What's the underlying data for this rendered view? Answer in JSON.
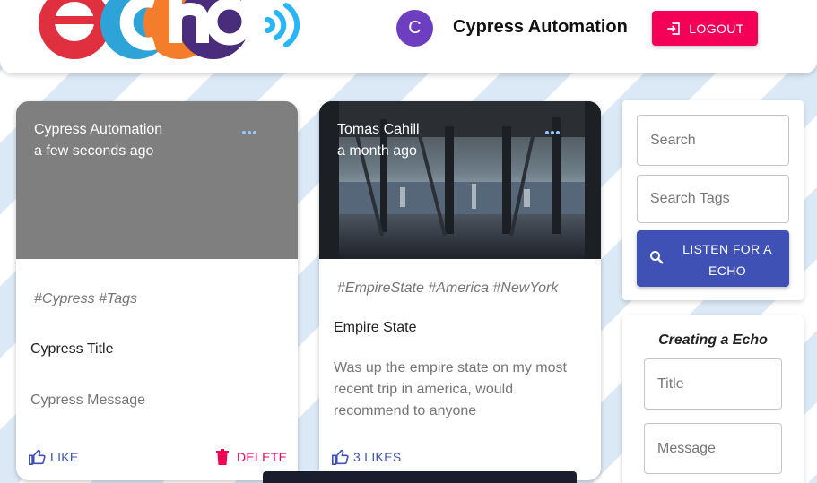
{
  "header": {
    "logo_text": "echo",
    "avatar_initial": "C",
    "username": "Cypress Automation",
    "logout_label": "LOGOUT"
  },
  "posts": [
    {
      "author": "Cypress Automation",
      "time": "a few seconds ago",
      "tags": "#Cypress #Tags",
      "title": "Cypress Title",
      "message": "Cypress Message",
      "like_label": "LIKE",
      "delete_label": "DELETE"
    },
    {
      "author": "Tomas Cahill",
      "time": "a month ago",
      "tags": "#EmpireState #America #NewYork",
      "title": "Empire State",
      "message": "Was up the empire state on my most recent trip in america, would recommend to anyone",
      "like_label": "3 LIKES"
    }
  ],
  "search": {
    "search_placeholder": "Search",
    "tags_placeholder": "Search Tags",
    "listen_label": "LISTEN FOR A ECHO"
  },
  "create": {
    "heading": "Creating a Echo",
    "title_placeholder": "Title",
    "message_placeholder": "Message"
  },
  "colors": {
    "primary": "#3f51b5",
    "secondary": "#f50057",
    "avatar": "#6d3fc0"
  },
  "icons": [
    "logout-icon",
    "more-icon",
    "thumb-up-icon",
    "delete-icon",
    "search-icon",
    "sound-waves-icon"
  ]
}
